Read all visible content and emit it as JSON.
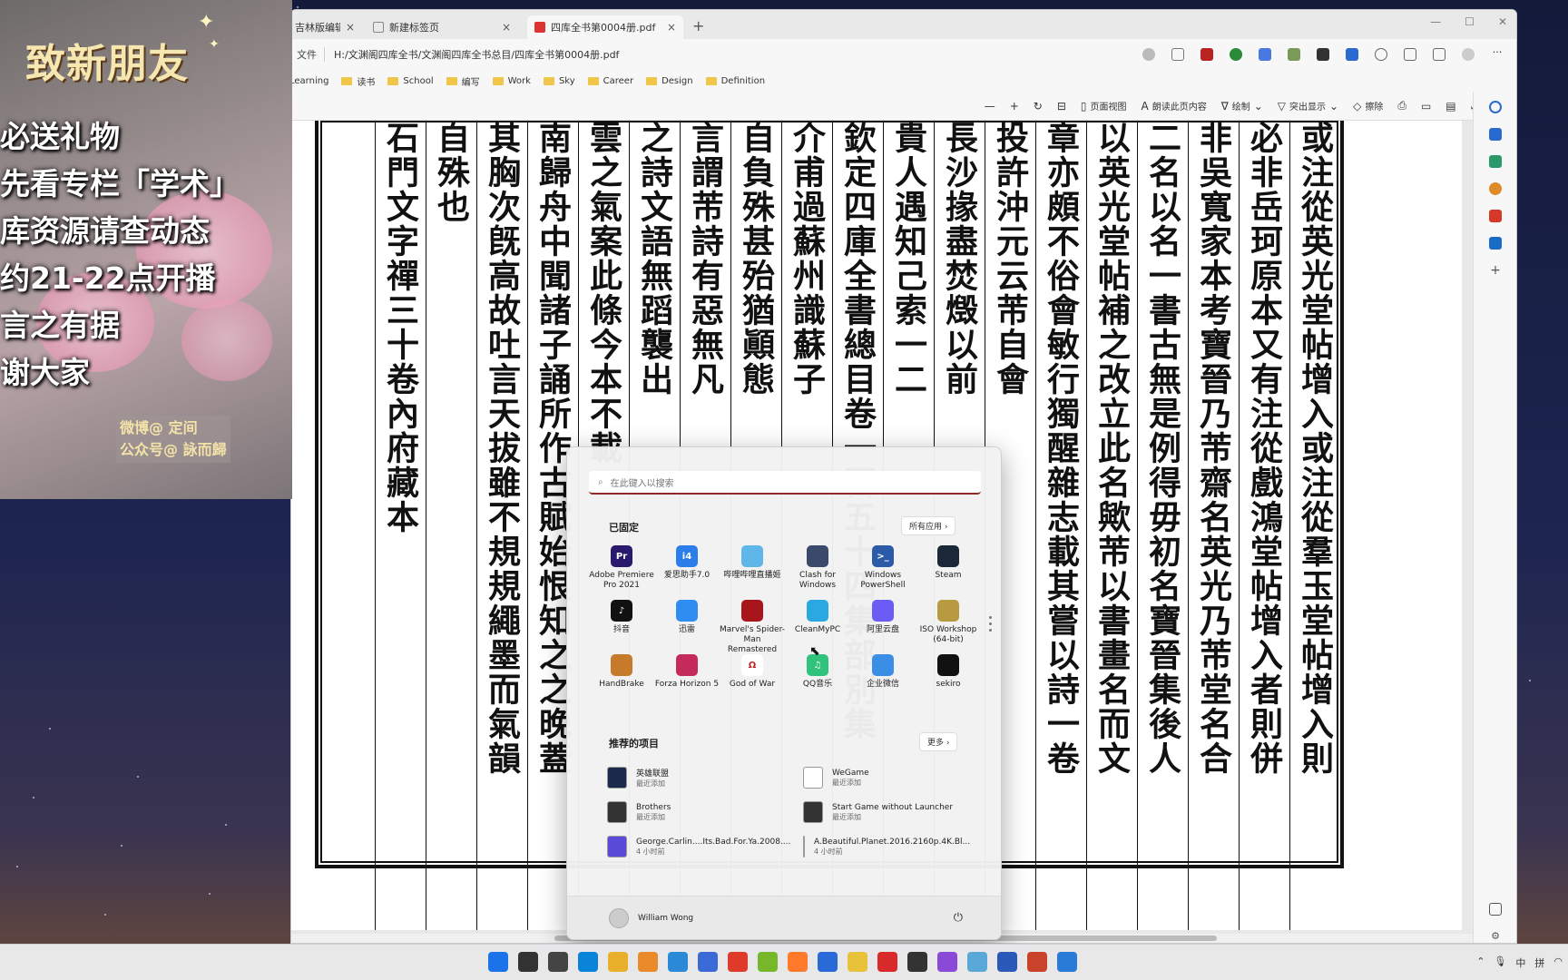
{
  "browser": {
    "tabs": [
      {
        "label": "吉林版编辑部"
      },
      {
        "label": "新建标签页"
      },
      {
        "label": "四库全书第0004册.pdf"
      }
    ],
    "file_chip": "文件",
    "url": "H:/文渊阁四库全书/文渊阁四库全书总目/四库全书第0004册.pdf",
    "bookmarks": [
      "Learning",
      "读书",
      "School",
      "编写",
      "Work",
      "Sky",
      "Career",
      "Design",
      "Definition"
    ]
  },
  "pdf_toolbar": {
    "page_view": "页面视图",
    "read_aloud": "朗读此页内容",
    "draw": "绘制",
    "highlight": "突出显示",
    "erase": "擦除"
  },
  "pdf_page": {
    "columns": [
      "石門文字禪三十卷內府藏本",
      "自殊也",
      "其胸次旣高故吐言天拔雖不規規繩墨而氣韻",
      "南歸舟中聞諸子誦所作古賦始恨知之之晚蓋",
      "雲之氣案此條今本不載",
      "之詩文語無蹈襲出",
      "言謂芾詩有惡無凡",
      "自負殊甚殆猶顚態",
      "介甫過蘇州識蘇子",
      "欽定四庫全書總目卷一百五十四集部別集",
      "貴人遇知己索一二",
      "長沙掾盡焚燬以前",
      "投許沖元云芾自會",
      "章亦頗不俗會敏行獨醒雜志載其嘗以詩一卷",
      "以英光堂帖補之改立此名歟芾以書畫名而文",
      "二名以名一書古無是例得毋初名寶晉集後人",
      "非吳寬家本考寶晉乃芾齋名英光乃芾堂名合",
      "必非岳珂原本又有注從戲鴻堂帖增入者則併",
      "或注從英光堂帖增入或注從羣玉堂帖增入則"
    ]
  },
  "overlay": {
    "title": "致新朋友",
    "lines": [
      "必送礼物",
      "先看专栏「学术」",
      "库资源请查动态",
      "约21-22点开播",
      "言之有据",
      "谢大家"
    ],
    "credit_1": "微博@ 定间",
    "credit_2": "公众号@ 詠而歸"
  },
  "start_menu": {
    "search_placeholder": "在此键入以搜索",
    "pinned_title": "已固定",
    "all_apps": "所有应用  ›",
    "pinned": [
      {
        "name": "Adobe Premiere Pro 2021",
        "icon": "premiere-icon",
        "color": "#2a1a6e",
        "glyph": "Pr"
      },
      {
        "name": "爱思助手7.0",
        "icon": "i4-icon",
        "color": "#2b7de9",
        "glyph": "i4"
      },
      {
        "name": "哔哩哔哩直播姬",
        "icon": "bilibili-live-icon",
        "color": "#5fb6e8",
        "glyph": ""
      },
      {
        "name": "Clash for Windows",
        "icon": "clash-icon",
        "color": "#3a4a6a",
        "glyph": ""
      },
      {
        "name": "Windows PowerShell",
        "icon": "powershell-icon",
        "color": "#2a5aa8",
        "glyph": ">_"
      },
      {
        "name": "Steam",
        "icon": "steam-icon",
        "color": "#1b2838",
        "glyph": ""
      },
      {
        "name": "抖音",
        "icon": "douyin-icon",
        "color": "#111111",
        "glyph": "♪"
      },
      {
        "name": "迅雷",
        "icon": "xunlei-icon",
        "color": "#2f8cf0",
        "glyph": ""
      },
      {
        "name": "Marvel's Spider-Man Remastered",
        "icon": "spiderman-icon",
        "color": "#a8161c",
        "glyph": ""
      },
      {
        "name": "CleanMyPC",
        "icon": "cleanmypc-icon",
        "color": "#29a9e0",
        "glyph": ""
      },
      {
        "name": "阿里云盘",
        "icon": "aliyun-drive-icon",
        "color": "#6b5cf6",
        "glyph": ""
      },
      {
        "name": "ISO Workshop (64-bit)",
        "icon": "iso-workshop-icon",
        "color": "#b89a40",
        "glyph": ""
      },
      {
        "name": "HandBrake",
        "icon": "handbrake-icon",
        "color": "#c77a2a",
        "glyph": ""
      },
      {
        "name": "Forza Horizon 5",
        "icon": "forza-icon",
        "color": "#c42a5a",
        "glyph": ""
      },
      {
        "name": "God of War",
        "icon": "god-of-war-icon",
        "color": "#ffffff",
        "glyph": "Ω"
      },
      {
        "name": "QQ音乐",
        "icon": "qq-music-icon",
        "color": "#31c27c",
        "glyph": "♫"
      },
      {
        "name": "企业微信",
        "icon": "wecom-icon",
        "color": "#3a8ee6",
        "glyph": ""
      },
      {
        "name": "sekiro",
        "icon": "sekiro-icon",
        "color": "#111111",
        "glyph": ""
      }
    ],
    "recommended_title": "推荐的项目",
    "more": "更多  ›",
    "recommended": [
      {
        "name": "英雄联盟",
        "sub": "最近添加",
        "icon": "lol-icon",
        "color": "#1a2a4a"
      },
      {
        "name": "WeGame",
        "sub": "最近添加",
        "icon": "file-icon",
        "color": "#ffffff"
      },
      {
        "name": "Brothers",
        "sub": "最近添加",
        "icon": "brothers-icon",
        "color": "#333333"
      },
      {
        "name": "Start Game without Launcher",
        "sub": "最近添加",
        "icon": "game-icon",
        "color": "#333333"
      },
      {
        "name": "George.Carlin....Its.Bad.For.Ya.2008....",
        "sub": "4 小时前",
        "icon": "video-file-icon",
        "color": "#5a4ad8"
      },
      {
        "name": "A.Beautiful.Planet.2016.2160p.4K.Bl...",
        "sub": "4 小时前",
        "icon": "video-file-icon",
        "color": "#3a8ee6"
      }
    ],
    "user": "William Wong"
  },
  "taskbar": {
    "icons": [
      "windows-start-icon",
      "search-icon",
      "task-view-icon",
      "edge-icon",
      "file-explorer-icon",
      "everything-icon",
      "app-icon",
      "notepad-icon",
      "chrome-icon",
      "nvidia-icon",
      "firefox-icon",
      "app-icon",
      "folder-icon",
      "dx-icon",
      "app-icon",
      "app-icon",
      "app-icon",
      "word-icon",
      "powerpoint-icon",
      "mail-icon"
    ],
    "tray": [
      "中",
      "拼"
    ]
  }
}
